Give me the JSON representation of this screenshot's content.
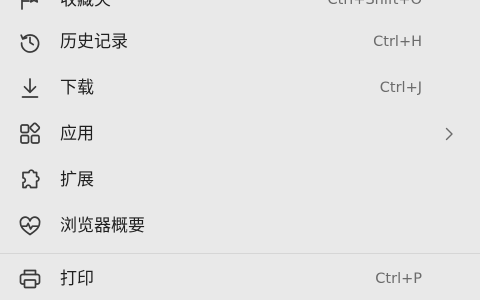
{
  "menu": {
    "items": [
      {
        "label": "收藏夹",
        "shortcut": "Ctrl+Shift+O",
        "icon": "favorites-icon"
      },
      {
        "label": "历史记录",
        "shortcut": "Ctrl+H",
        "icon": "history-icon"
      },
      {
        "label": "下载",
        "shortcut": "Ctrl+J",
        "icon": "download-icon"
      },
      {
        "label": "应用",
        "shortcut": "",
        "icon": "apps-icon",
        "has_submenu": true
      },
      {
        "label": "扩展",
        "shortcut": "",
        "icon": "extensions-icon"
      },
      {
        "label": "浏览器概要",
        "shortcut": "",
        "icon": "browser-essentials-icon"
      },
      {
        "label": "打印",
        "shortcut": "Ctrl+P",
        "icon": "print-icon"
      }
    ]
  },
  "colors": {
    "background": "#e9e9e9",
    "text": "#1f1f1f",
    "shortcut_text": "#6b6b6b",
    "icon_stroke": "#3a3a3a"
  }
}
